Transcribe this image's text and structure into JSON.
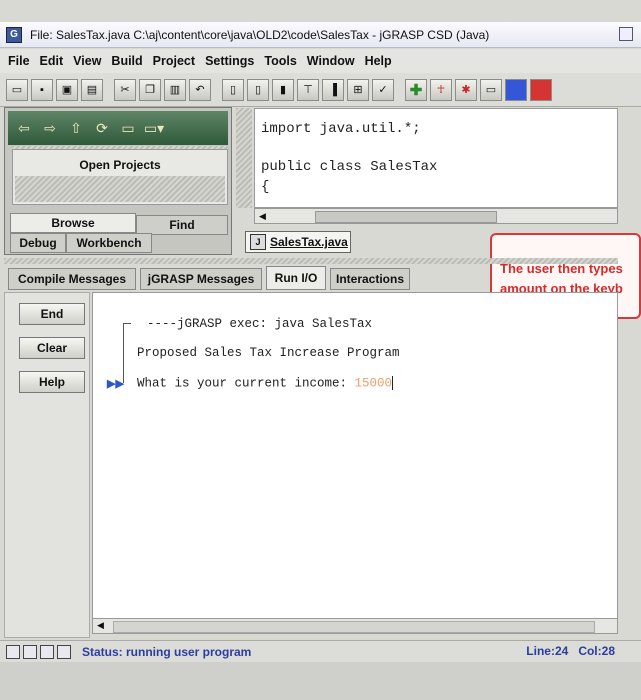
{
  "window": {
    "title": "File: SalesTax.java  C:\\aj\\content\\core\\java\\OLD2\\code\\SalesTax - jGRASP CSD (Java)"
  },
  "menu": {
    "items": [
      "File",
      "Edit",
      "View",
      "Build",
      "Project",
      "Settings",
      "Tools",
      "Window",
      "Help"
    ]
  },
  "left_panel": {
    "open_projects_label": "Open Projects",
    "tabs": [
      "Browse",
      "Find",
      "Debug",
      "Workbench"
    ]
  },
  "editor": {
    "lines": [
      "import java.util.*;",
      "",
      "public class SalesTax",
      "{"
    ],
    "file_tab": "SalesTax.java"
  },
  "annotation": {
    "text_line1": "The user then types",
    "text_line2": "amount on the keyb",
    "color": "#d62b2b"
  },
  "messages": {
    "tabs": [
      "Compile Messages",
      "jGRASP Messages",
      "Run I/O",
      "Interactions"
    ],
    "active_tab": "Run I/O"
  },
  "side_buttons": [
    "End",
    "Clear",
    "Help"
  ],
  "run_io": {
    "exec_line": "----jGRASP exec: java SalesTax",
    "program_title": "Proposed Sales Tax Increase Program",
    "prompt": "What is your current income: ",
    "input_value": "15000",
    "input_color": "#e8a06a",
    "arrow_marker": "▶▶"
  },
  "status": {
    "text": "Status: running user program",
    "line": "Line:24",
    "col": "Col:28",
    "color": "#2a3ea0"
  }
}
